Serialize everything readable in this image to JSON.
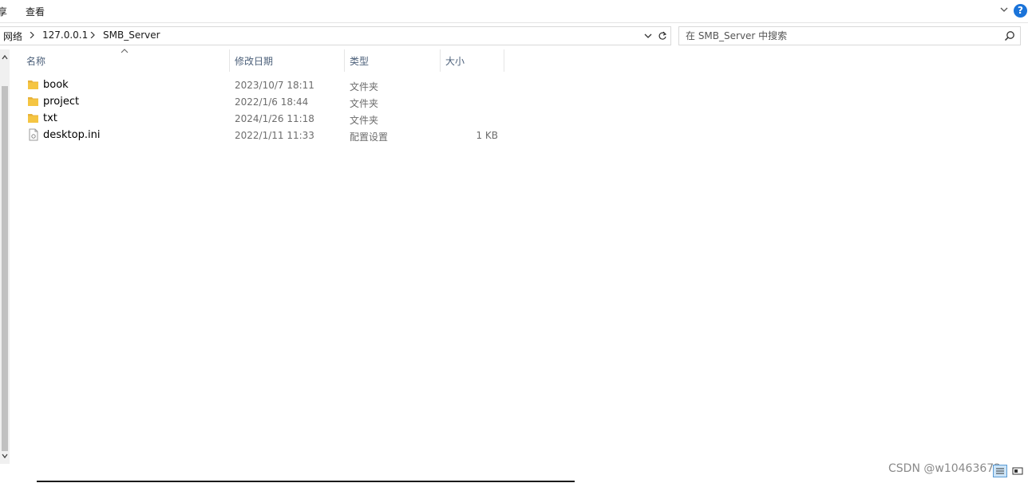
{
  "ribbon": {
    "cut_glyph": "享",
    "view_tab": "查看"
  },
  "address": {
    "crumbs": [
      "网络",
      "127.0.0.1",
      "SMB_Server"
    ]
  },
  "search": {
    "placeholder": "在 SMB_Server 中搜索"
  },
  "columns": {
    "name": "名称",
    "date": "修改日期",
    "type": "类型",
    "size": "大小"
  },
  "files": [
    {
      "name": "book",
      "date": "2023/10/7 18:11",
      "type": "文件夹",
      "size": "",
      "icon": "folder-icon"
    },
    {
      "name": "project",
      "date": "2022/1/6 18:44",
      "type": "文件夹",
      "size": "",
      "icon": "folder-icon"
    },
    {
      "name": "txt",
      "date": "2024/1/26 11:18",
      "type": "文件夹",
      "size": "",
      "icon": "folder-icon"
    },
    {
      "name": "desktop.ini",
      "date": "2022/1/11 11:33",
      "type": "配置设置",
      "size": "1 KB",
      "icon": "config-file-icon"
    }
  ],
  "watermark": "CSDN @w10463672",
  "colors": {
    "accent": "#1a73d9",
    "folder": "#f5c542",
    "header_text": "#4c607a"
  }
}
